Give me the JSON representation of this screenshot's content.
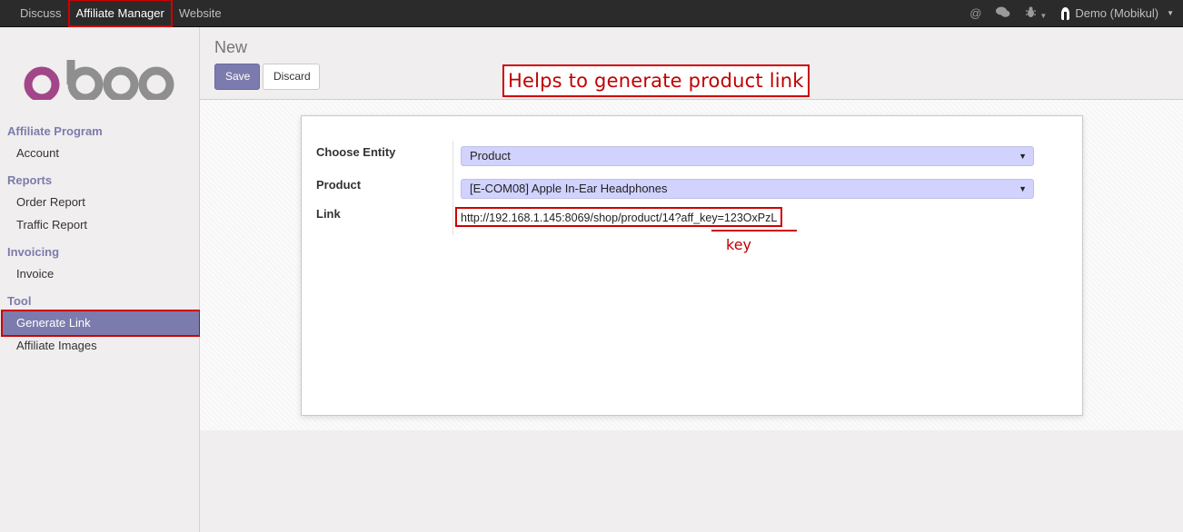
{
  "topbar": {
    "menu": [
      "Discuss",
      "Affiliate Manager",
      "Website"
    ],
    "user": "Demo (Mobikul)",
    "icons": [
      "at-icon",
      "chat-icon",
      "bug-icon"
    ]
  },
  "sidebar": {
    "logo": "odoo",
    "sections": [
      {
        "title": "Affiliate Program",
        "items": [
          "Account"
        ]
      },
      {
        "title": "Reports",
        "items": [
          "Order Report",
          "Traffic Report"
        ]
      },
      {
        "title": "Invoicing",
        "items": [
          "Invoice"
        ]
      },
      {
        "title": "Tool",
        "items": [
          "Generate Link",
          "Affiliate Images"
        ]
      }
    ],
    "active_item": "Generate Link"
  },
  "main": {
    "breadcrumb": "New",
    "save_label": "Save",
    "discard_label": "Discard",
    "callout": "Helps to generate product link",
    "form": {
      "entity_label": "Choose Entity",
      "entity_value": "Product",
      "product_label": "Product",
      "product_value": "[E-COM08] Apple In-Ear Headphones",
      "link_label": "Link",
      "link_value": "http://192.168.1.145:8069/shop/product/14?aff_key=123OxPzL",
      "key_note": "key"
    }
  },
  "colors": {
    "accent": "#7c7bad",
    "highlight": "#d00000",
    "select_bg": "#d2d2ff"
  }
}
